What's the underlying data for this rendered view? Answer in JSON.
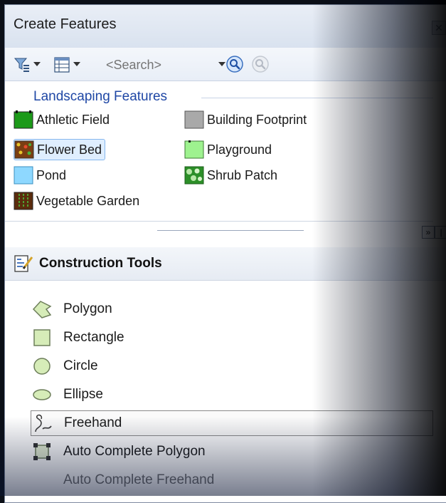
{
  "window": {
    "title": "Create Features"
  },
  "toolbar": {
    "search_placeholder": "<Search>"
  },
  "features": {
    "group_title": "Landscaping Features",
    "templates": [
      {
        "label": "Athletic Field",
        "color": "#1c9a19"
      },
      {
        "label": "Building Footprint",
        "color": "#a9a9a9"
      },
      {
        "label": "Flower Bed",
        "color": "#7a3e12",
        "selected": true
      },
      {
        "label": "Playground",
        "color": "#9ef28f"
      },
      {
        "label": "Pond",
        "color": "#8ed8ff"
      },
      {
        "label": "Shrub Patch",
        "color": "#2c8f28"
      },
      {
        "label": "Vegetable Garden",
        "color": "#5b2c0d"
      }
    ]
  },
  "tools_header": {
    "label": "Construction Tools"
  },
  "tools": [
    {
      "label": "Polygon",
      "icon": "polygon-icon"
    },
    {
      "label": "Rectangle",
      "icon": "rectangle-icon"
    },
    {
      "label": "Circle",
      "icon": "circle-icon"
    },
    {
      "label": "Ellipse",
      "icon": "ellipse-icon"
    },
    {
      "label": "Freehand",
      "icon": "freehand-icon",
      "selected": true
    },
    {
      "label": "Auto Complete Polygon",
      "icon": "auto-complete-polygon-icon"
    },
    {
      "label": "Auto Complete Freehand",
      "icon": "auto-complete-freehand-icon",
      "disabled": true
    }
  ],
  "colors": {
    "accent_blue": "#1f47a5",
    "selection_fill": "#dfeefe",
    "selection_border": "#86b7ee"
  }
}
